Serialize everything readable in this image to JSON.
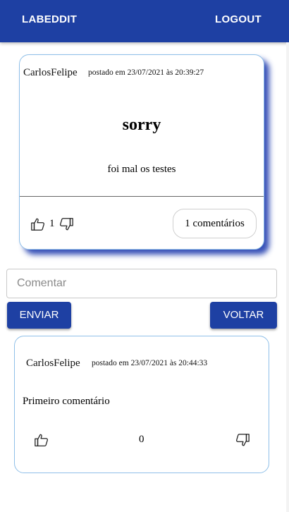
{
  "header": {
    "brand": "LABEDDIT",
    "logout_label": "LOGOUT"
  },
  "post": {
    "author": "CarlosFelipe",
    "meta": "postado em 23/07/2021 às 20:39:27",
    "title": "sorry",
    "body": "foi mal os testes",
    "vote_count": "1",
    "comments_label": "1 comentários"
  },
  "comment_form": {
    "placeholder": "Comentar",
    "send_label": "ENVIAR",
    "back_label": "VOLTAR"
  },
  "comments": [
    {
      "author": "CarlosFelipe",
      "meta": "postado em 23/07/2021 às 20:44:33",
      "body": "Primeiro comentário",
      "vote_count": "0"
    }
  ],
  "icons": {
    "upvote": "thumb-up-outline-icon",
    "downvote": "thumb-down-outline-icon"
  },
  "colors": {
    "primary": "#1e40a3",
    "card_border": "#8fbfe8",
    "card_shadow": "#1432aa"
  }
}
